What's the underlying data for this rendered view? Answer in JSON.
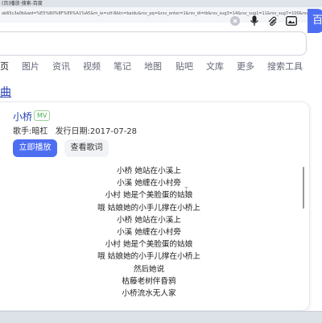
{
  "browser": {
    "tab_title": "(页)播放·搜索-百度",
    "url": "ab65c3a0b&wd=%E5%B0%8F%E6%A1%A5&rn_ie=utf-8&tn=baidu&rsv_pq=&rsv_enter=1&rsv_dl=tb&rsv_sug3=14&rsv_sug1=11&rsv_sug7=100&rsv_btype=i&prefixsug=%E5%B0%8F%E6%A1%A5&rsp=0"
  },
  "search": {
    "clear_icon": "×",
    "search_button": "百"
  },
  "nav": {
    "tabs": [
      "页",
      "图片",
      "资讯",
      "视频",
      "笔记",
      "地图",
      "贴吧",
      "文库",
      "更多",
      "搜索工具"
    ]
  },
  "result": {
    "title": "曲",
    "song_name": "小桥",
    "badge": "MV",
    "singer": "歌手:暗杠",
    "release": "发行日期:2017-07-28",
    "play_button": "立即播放",
    "lyrics_button": "查看歌词",
    "lyrics": [
      "小桥 她站在小溪上",
      "小溪 她缠在小村旁",
      "小村 她是个美脸蛋的姑娘",
      "哦 姑娘她的小手儿撑在小桥上",
      "小桥 她站在小溪上",
      "小溪 她缠在小村旁",
      "小村 她是个美脸蛋的姑娘",
      "哦 姑娘她的小手儿撑在小桥上",
      "然后她说",
      "枯藤老树伴昏鸦",
      "小桥流水无人家"
    ]
  },
  "colors": {
    "accent": "#4e6ef2",
    "link": "#2440b3",
    "badge_green": "#4cae4c"
  }
}
